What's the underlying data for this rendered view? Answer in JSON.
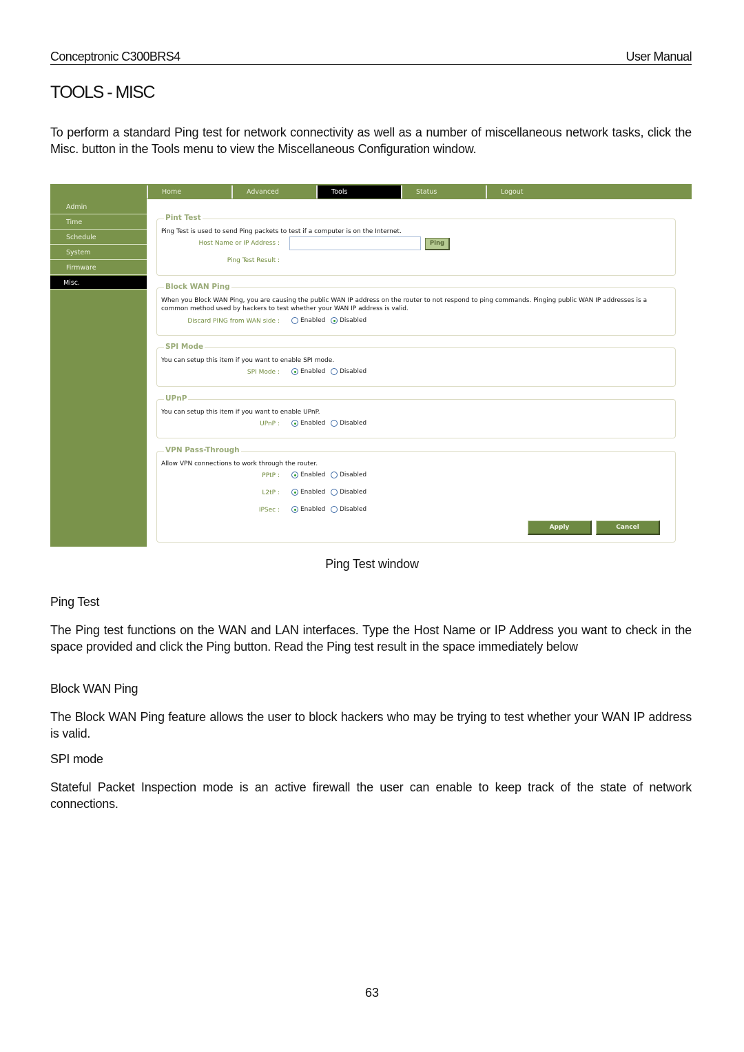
{
  "header": {
    "product": "Conceptronic C300BRS4",
    "doc_type": "User Manual"
  },
  "section_title": "TOOLS - MISC",
  "intro": "To perform a standard Ping test for network connectivity as well as a number of miscellaneous network tasks, click the Misc. button in the Tools menu to view the Miscellaneous Configuration window.",
  "screenshot": {
    "colors": {
      "brand_green": "#7a934b",
      "active_black": "#000000",
      "label_green": "#6f8a3a"
    },
    "nav_tabs": [
      {
        "label": "Home",
        "active": false
      },
      {
        "label": "Advanced",
        "active": false
      },
      {
        "label": "Tools",
        "active": true
      },
      {
        "label": "Status",
        "active": false
      },
      {
        "label": "Logout",
        "active": false
      }
    ],
    "sidebar": [
      {
        "label": "Admin",
        "active": false
      },
      {
        "label": "Time",
        "active": false
      },
      {
        "label": "Schedule",
        "active": false
      },
      {
        "label": "System",
        "active": false
      },
      {
        "label": "Firmware",
        "active": false
      },
      {
        "label": "Misc.",
        "active": true
      }
    ],
    "ping_test": {
      "legend": "Pint Test",
      "description": "Ping Test is used to send Ping packets to test if a computer is on the Internet.",
      "host_label": "Host Name or IP Address :",
      "host_value": "",
      "ping_button": "Ping",
      "result_label": "Ping Test Result :",
      "result_value": ""
    },
    "block_wan_ping": {
      "legend": "Block WAN Ping",
      "description": "When you Block WAN Ping, you are causing the public WAN IP address on the router to not respond to ping commands. Pinging public WAN IP addresses is a common method used by hackers to test whether your WAN IP address is valid.",
      "field_label": "Discard PING from WAN side :",
      "selected": "Disabled"
    },
    "spi_mode": {
      "legend": "SPI Mode",
      "description": "You can setup this item if you want to enable SPI mode.",
      "field_label": "SPI Mode :",
      "selected": "Enabled"
    },
    "upnp": {
      "legend": "UPnP",
      "description": "You can setup this item if you want to enable UPnP.",
      "field_label": "UPnP :",
      "selected": "Enabled"
    },
    "vpn": {
      "legend": "VPN Pass-Through",
      "description": "Allow VPN connections to work through the router.",
      "rows": [
        {
          "label": "PPtP :",
          "selected": "Enabled"
        },
        {
          "label": "L2tP :",
          "selected": "Enabled"
        },
        {
          "label": "IPSec :",
          "selected": "Enabled"
        }
      ]
    },
    "options": {
      "enabled": "Enabled",
      "disabled": "Disabled"
    },
    "apply_button": "Apply",
    "cancel_button": "Cancel"
  },
  "caption": "Ping Test window",
  "sections": [
    {
      "heading": "Ping Test",
      "body": "The Ping test functions on the WAN and LAN interfaces. Type the Host Name or IP Address you want to check in the space provided and click the Ping button. Read the Ping test result in the space immediately below"
    },
    {
      "heading": "Block WAN Ping",
      "body": "The Block WAN Ping feature allows the user to block hackers who may be trying to test whether your WAN IP address is valid."
    },
    {
      "heading": "SPI mode",
      "body": "Stateful Packet Inspection mode is an active firewall the user can enable to keep track of the state of network connections."
    }
  ],
  "page_number": "63"
}
